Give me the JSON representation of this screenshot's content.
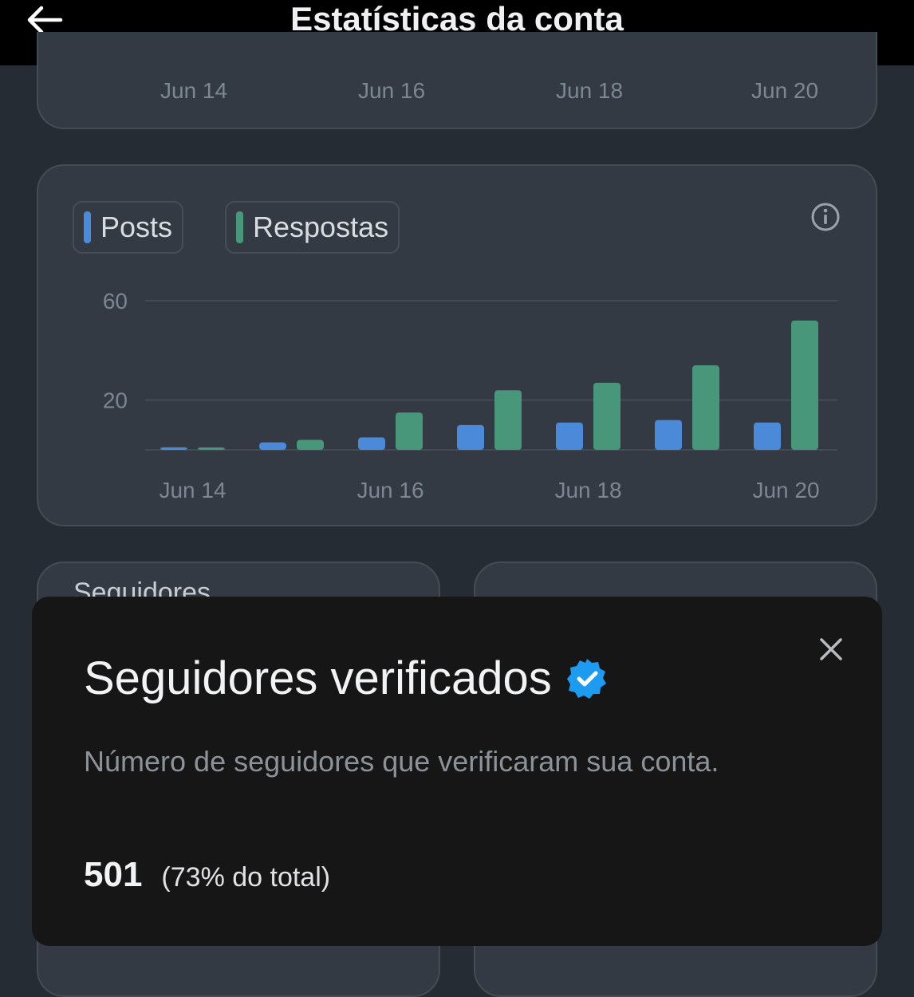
{
  "header": {
    "title": "Estatísticas da conta"
  },
  "top_chart": {
    "x_ticks": [
      "Jun 14",
      "Jun 16",
      "Jun 18",
      "Jun 20"
    ]
  },
  "legend": {
    "posts": "Posts",
    "respostas": "Respostas"
  },
  "colors": {
    "posts": "#4a8ad8",
    "respostas": "#48977a",
    "accent": "#1d9bf0"
  },
  "cards": {
    "seguidores_label": "Seguidores"
  },
  "sheet": {
    "title": "Seguidores verificados",
    "description": "Número de seguidores que verificaram sua conta.",
    "value": "501",
    "percent": "(73% do total)"
  },
  "chart_data": {
    "type": "bar",
    "categories": [
      "Jun 14",
      "Jun 15",
      "Jun 16",
      "Jun 17",
      "Jun 18",
      "Jun 19",
      "Jun 20"
    ],
    "series": [
      {
        "name": "Posts",
        "values": [
          1,
          3,
          5,
          10,
          11,
          12,
          11
        ]
      },
      {
        "name": "Respostas",
        "values": [
          0.5,
          4,
          15,
          24,
          27,
          34,
          52
        ]
      }
    ],
    "y_ticks": [
      60,
      20
    ],
    "x_ticks": [
      "Jun 14",
      "Jun 16",
      "Jun 18",
      "Jun 20"
    ],
    "ylim": [
      0,
      60
    ]
  }
}
